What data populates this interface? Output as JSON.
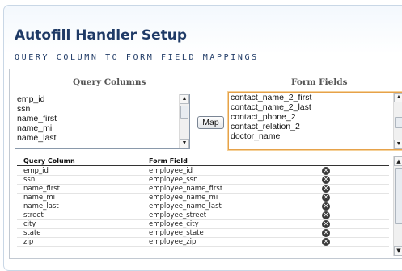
{
  "page": {
    "title": "Autofill Handler Setup",
    "subtitle": "QUERY COLUMN TO FORM FIELD MAPPINGS"
  },
  "query_columns": {
    "header": "Query Columns",
    "items": [
      "emp_id",
      "ssn",
      "name_first",
      "name_mi",
      "name_last"
    ]
  },
  "form_fields": {
    "header": "Form Fields",
    "items": [
      "contact_name_2_first",
      "contact_name_2_last",
      "contact_phone_2",
      "contact_relation_2",
      "doctor_name"
    ]
  },
  "map_button": {
    "label": "Map"
  },
  "mappings_table": {
    "columns": [
      "Query Column",
      "Form Field"
    ],
    "rows": [
      [
        "emp_id",
        "employee_id"
      ],
      [
        "ssn",
        "employee_ssn"
      ],
      [
        "name_first",
        "employee_name_first"
      ],
      [
        "name_mi",
        "employee_name_mi"
      ],
      [
        "name_last",
        "employee_name_last"
      ],
      [
        "street",
        "employee_street"
      ],
      [
        "city",
        "employee_city"
      ],
      [
        "state",
        "employee_state"
      ],
      [
        "zip",
        "employee_zip"
      ]
    ],
    "remove_icon": "remove-circle-icon"
  },
  "colors": {
    "title": "#1f3a66",
    "focus_border": "#e6a24a"
  }
}
